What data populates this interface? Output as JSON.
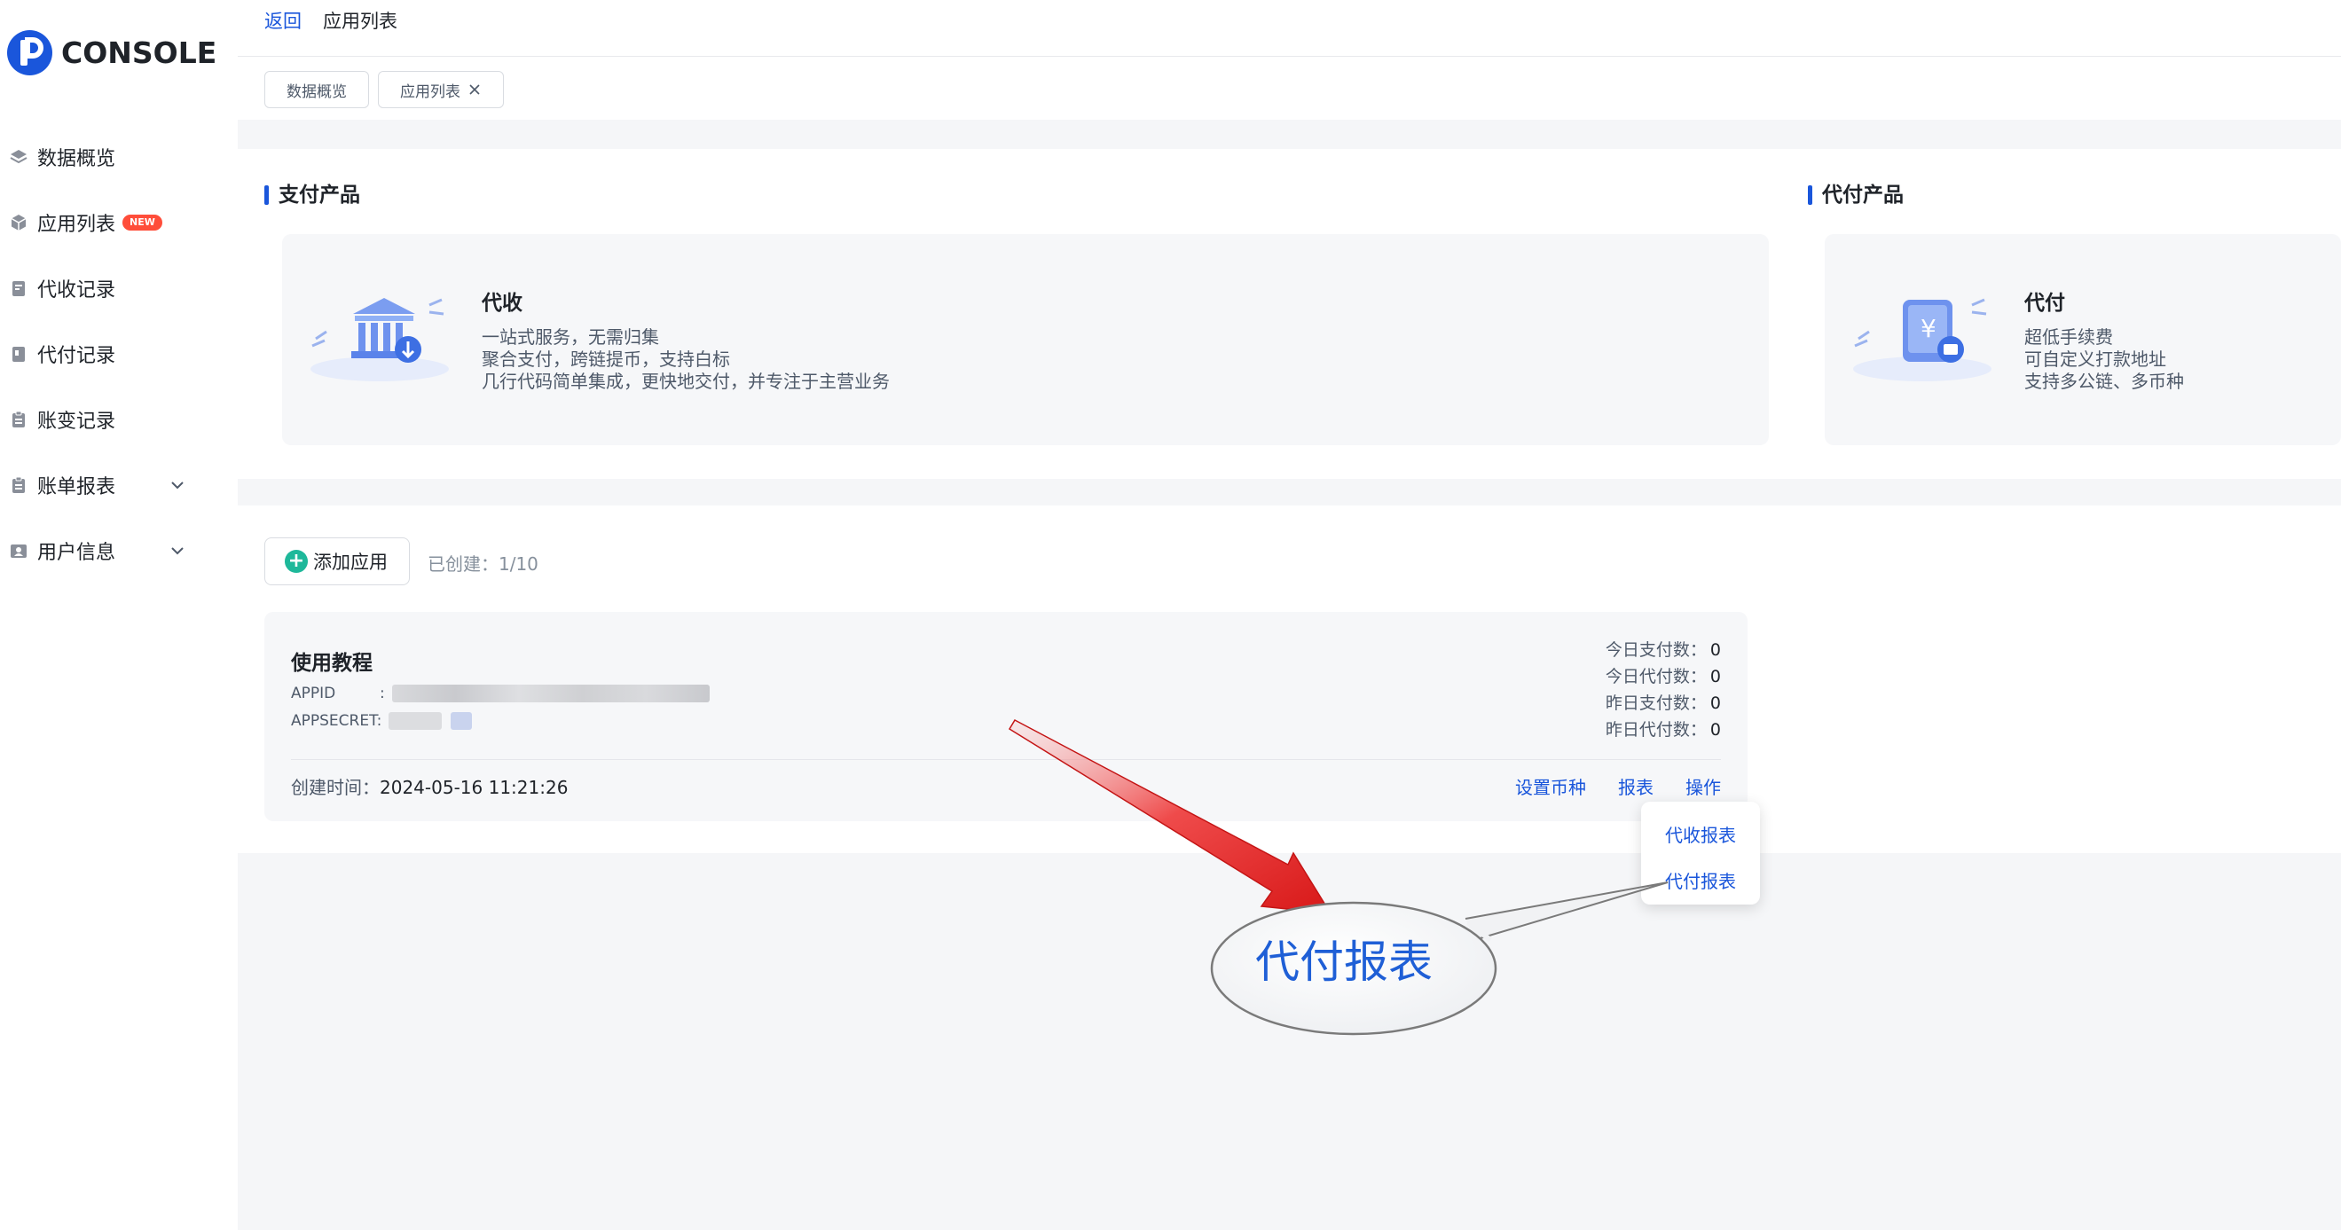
{
  "brand": {
    "name": "CONSOLE"
  },
  "sidebar": {
    "items": [
      {
        "label": "数据概览",
        "icon": "layers-icon"
      },
      {
        "label": "应用列表",
        "icon": "cube-icon",
        "badge": "NEW"
      },
      {
        "label": "代收记录",
        "icon": "receipt-icon"
      },
      {
        "label": "代付记录",
        "icon": "document-icon"
      },
      {
        "label": "账变记录",
        "icon": "clipboard-icon"
      },
      {
        "label": "账单报表",
        "icon": "clipboard-icon",
        "expandable": true
      },
      {
        "label": "用户信息",
        "icon": "id-card-icon",
        "expandable": true
      }
    ]
  },
  "header": {
    "back": "返回",
    "current": "应用列表",
    "tabs": [
      {
        "label": "数据概览",
        "closable": false
      },
      {
        "label": "应用列表",
        "closable": true
      }
    ]
  },
  "products": {
    "pay_title": "支付产品",
    "payout_title": "代付产品",
    "collect": {
      "name": "代收",
      "lines": [
        "一站式服务，无需归集",
        "聚合支付，跨链提币，支持白标",
        "几行代码简单集成，更快地交付，并专注于主营业务"
      ]
    },
    "payout": {
      "name": "代付",
      "lines": [
        "超低手续费",
        "可自定义打款地址",
        "支持多公链、多币种"
      ]
    }
  },
  "apps": {
    "add_label": "添加应用",
    "created_label": "已创建：1/10",
    "card": {
      "title": "使用教程",
      "appid_key": "APPID",
      "appid_sep": ":",
      "appsecret_key": "APPSECRET:",
      "stats": [
        {
          "label": "今日支付数：",
          "value": "0"
        },
        {
          "label": "今日代付数：",
          "value": "0"
        },
        {
          "label": "昨日支付数：",
          "value": "0"
        },
        {
          "label": "昨日代付数：",
          "value": "0"
        }
      ],
      "created_time_label": "创建时间：",
      "created_time_value": "2024-05-16 11:21:26",
      "actions": [
        "设置币种",
        "报表",
        "操作"
      ]
    },
    "dropdown": [
      "代收报表",
      "代付报表"
    ]
  },
  "annotation": {
    "callout": "代付报表"
  },
  "colors": {
    "accent": "#1a56db",
    "badge": "#ff4d3a",
    "add_icon": "#1eb89a",
    "arrow": "#e8232a"
  }
}
